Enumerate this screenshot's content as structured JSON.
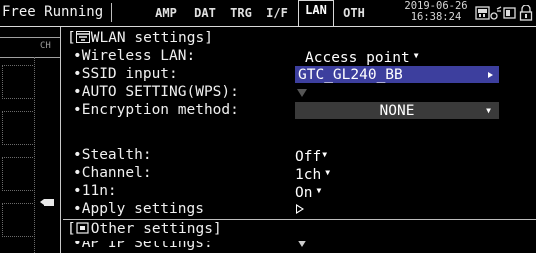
{
  "status": {
    "mode": "Free Running",
    "tabs": [
      {
        "label": "AMP",
        "active": false
      },
      {
        "label": "DAT",
        "active": false
      },
      {
        "label": "TRG",
        "active": false
      },
      {
        "label": "I/F",
        "active": false
      },
      {
        "label": "LAN",
        "active": true
      },
      {
        "label": "OTH",
        "active": false
      }
    ],
    "date": "2019-06-26",
    "time": "16:38:24",
    "icons": [
      "memory-card-icon",
      "antenna-icon",
      "screen-icon",
      "lock-icon"
    ]
  },
  "left": {
    "ch_label": "CH"
  },
  "wlan": {
    "header": "[",
    "header_title": "WLAN settings]",
    "items": [
      {
        "label": "•Wireless LAN:",
        "value": "Access point"
      },
      {
        "label": "•SSID input:",
        "value": "GTC_GL240_BB"
      },
      {
        "label": "•AUTO SETTING(WPS):",
        "value": ""
      },
      {
        "label": "•Encryption method:",
        "value": "NONE"
      },
      {
        "label": "•Stealth:",
        "value": "Off"
      },
      {
        "label": "•Channel:",
        "value": "1ch"
      },
      {
        "label": "•11n:",
        "value": "On"
      },
      {
        "label": "•Apply settings",
        "value": ""
      }
    ]
  },
  "other": {
    "header": "[",
    "header_title": "Other settings]",
    "partial_label": "•AP IP Settings:"
  },
  "colors": {
    "accent_blue": "#3d3f9e",
    "field_gray": "#3a3a3a",
    "background": "#000000",
    "text": "#f0f0f0"
  }
}
